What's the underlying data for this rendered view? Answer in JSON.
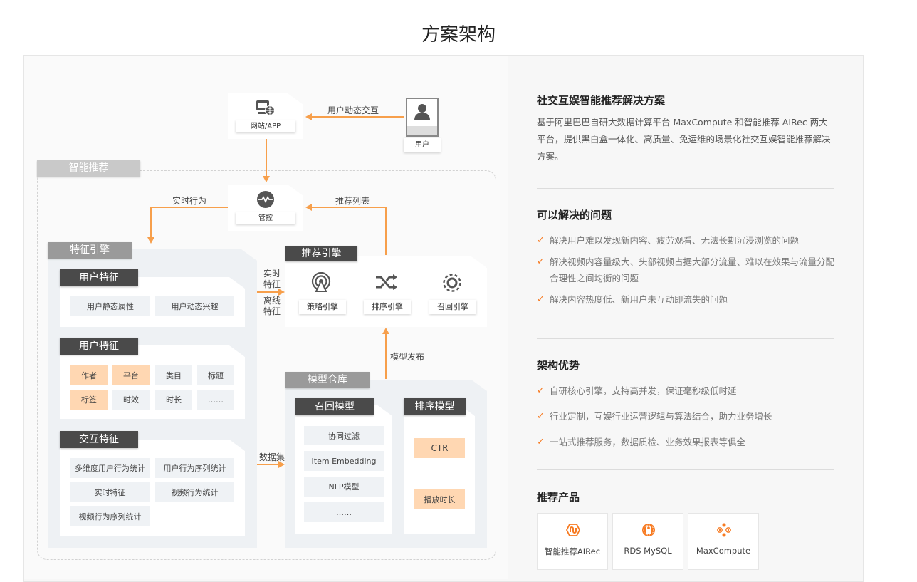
{
  "page_title": "方案架构",
  "diagram": {
    "website_app": {
      "label": "网站/APP",
      "icon": "monitor-globe-icon"
    },
    "user": {
      "label": "用户",
      "icon": "user-avatar-icon"
    },
    "control": {
      "label": "管控",
      "icon": "wave-circle-icon"
    },
    "smart_rec_group": "智能推荐",
    "arrows": {
      "user_interaction": "用户动态交互",
      "realtime_behavior": "实时行为",
      "rec_list": "推荐列表",
      "realtime_feature": "实时特征",
      "offline_feature": "离线特征",
      "model_release": "模型发布",
      "dataset": "数据集"
    },
    "feature_engine": {
      "title": "特征引擎",
      "groups": [
        {
          "title": "用户特征",
          "cells": [
            {
              "label": "用户静态属性",
              "highlight": false
            },
            {
              "label": "用户动态兴趣",
              "highlight": false
            }
          ]
        },
        {
          "title": "用户特征",
          "cells": [
            {
              "label": "作者",
              "highlight": true
            },
            {
              "label": "平台",
              "highlight": true
            },
            {
              "label": "类目",
              "highlight": false
            },
            {
              "label": "标题",
              "highlight": false
            },
            {
              "label": "标签",
              "highlight": true
            },
            {
              "label": "时效",
              "highlight": false
            },
            {
              "label": "时长",
              "highlight": false
            },
            {
              "label": "……",
              "highlight": false
            }
          ]
        },
        {
          "title": "交互特征",
          "cells": [
            {
              "label": "多维度用户行为统计",
              "highlight": false
            },
            {
              "label": "用户行为序列统计",
              "highlight": false
            },
            {
              "label": "实时特征",
              "highlight": false
            },
            {
              "label": "视频行为统计",
              "highlight": false
            },
            {
              "label": "视频行为序列统计",
              "highlight": false
            }
          ]
        }
      ]
    },
    "rec_engine": {
      "title": "推荐引擎",
      "items": [
        {
          "label": "策略引擎",
          "icon": "broadcast-icon"
        },
        {
          "label": "排序引擎",
          "icon": "shuffle-icon"
        },
        {
          "label": "召回引擎",
          "icon": "dashed-gear-icon"
        }
      ]
    },
    "model_warehouse": {
      "title": "模型仓库",
      "recall_model": {
        "title": "召回模型",
        "items": [
          "协同过滤",
          "Item Embedding",
          "NLP模型",
          "……"
        ]
      },
      "rank_model": {
        "title": "排序模型",
        "items": [
          "CTR",
          "播放时长"
        ]
      }
    }
  },
  "info": {
    "solution": {
      "title": "社交互娱智能推荐解决方案",
      "description": "基于阿里巴巴自研大数据计算平台 MaxCompute 和智能推荐 AIRec 两大平台，提供黑白盒一体化、高质量、免运维的场景化社交互娱智能推荐解决方案。"
    },
    "problems": {
      "title": "可以解决的问题",
      "items": [
        "解决用户难以发现新内容、疲劳观看、无法长期沉浸浏览的问题",
        "解决视频内容量级大、头部视频占据大部分流量、难以在效果与流量分配合理性之间均衡的问题",
        "解决内容热度低、新用户未互动即流失的问题"
      ]
    },
    "advantages": {
      "title": "架构优势",
      "items": [
        "自研核心引擎，支持高并发，保证毫秒级低时延",
        "行业定制，互娱行业运营逻辑与算法结合，助力业务增长",
        "一站式推荐服务，数据质检、业务效果报表等俱全"
      ]
    },
    "products": {
      "title": "推荐产品",
      "items": [
        {
          "name": "智能推荐AIRec",
          "icon": "airec-icon"
        },
        {
          "name": "RDS MySQL",
          "icon": "rds-lock-icon"
        },
        {
          "name": "MaxCompute",
          "icon": "maxcompute-nodes-icon"
        }
      ]
    },
    "check_symbol": "✓",
    "accent_color": "#f77a21",
    "arrow_color": "#f79f4b",
    "highlight_color": "#ffd7b2"
  }
}
